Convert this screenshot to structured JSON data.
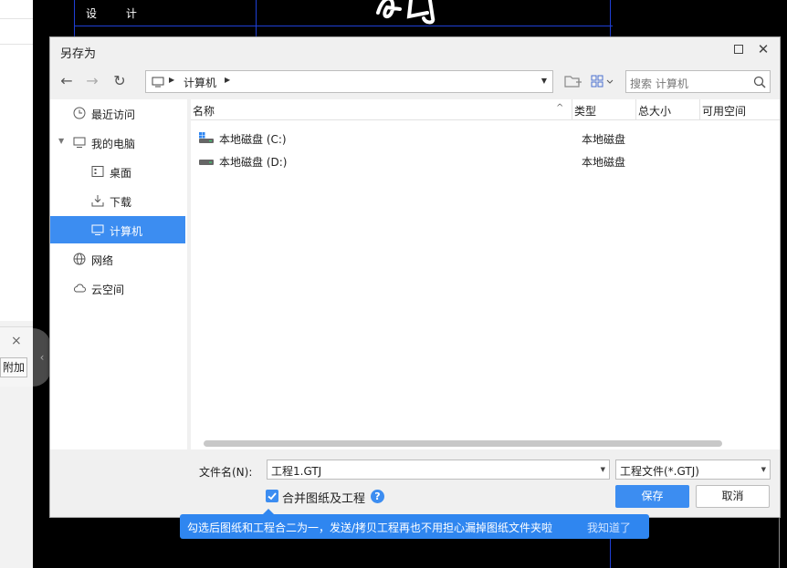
{
  "background": {
    "cad_label": "设 计",
    "attach_label": "附加",
    "close_glyph": "×"
  },
  "dialog": {
    "title": "另存为",
    "address": {
      "location": "计算机"
    },
    "search": {
      "placeholder": "搜索 计算机"
    },
    "sidebar": {
      "items": [
        {
          "label": "最近访问",
          "icon": "clock-icon"
        },
        {
          "label": "我的电脑",
          "icon": "computer-icon"
        },
        {
          "label": "桌面",
          "icon": "desktop-icon"
        },
        {
          "label": "下载",
          "icon": "download-icon"
        },
        {
          "label": "计算机",
          "icon": "computer-icon",
          "active": true
        },
        {
          "label": "网络",
          "icon": "globe-icon"
        },
        {
          "label": "云空间",
          "icon": "cloud-icon"
        }
      ]
    },
    "columns": [
      "名称",
      "类型",
      "总大小",
      "可用空间"
    ],
    "files": [
      {
        "name": "本地磁盘 (C:)",
        "type": "本地磁盘"
      },
      {
        "name": "本地磁盘 (D:)",
        "type": "本地磁盘"
      }
    ],
    "filename_label": "文件名(N):",
    "filename_value": "工程1.GTJ",
    "filetype_value": "工程文件(*.GTJ)",
    "merge_label": "合并图纸及工程",
    "merge_checked": true,
    "save_label": "保存",
    "cancel_label": "取消"
  },
  "tooltip": {
    "text": "勾选后图纸和工程合二为一，发送/拷贝工程再也不用担心漏掉图纸文件夹啦",
    "dismiss_label": "我知道了"
  },
  "colors": {
    "accent": "#3c8df1",
    "tooltip_bg": "#2f86f0"
  }
}
